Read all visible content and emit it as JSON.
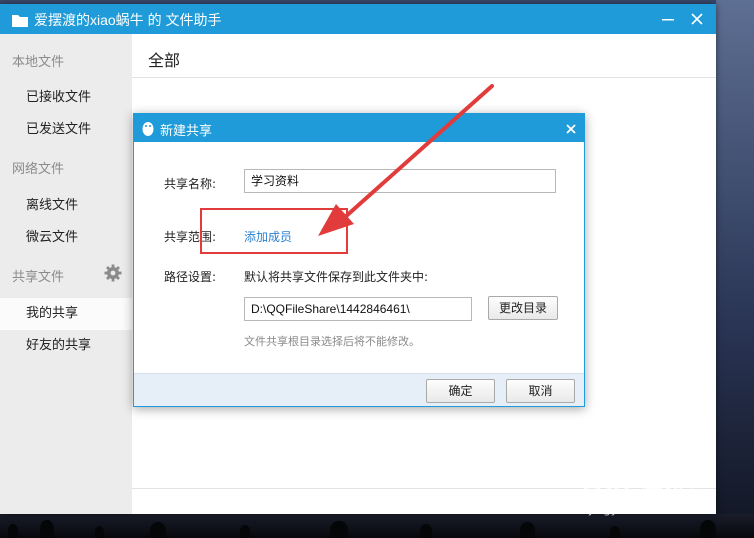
{
  "window": {
    "title": "爱摆渡的xiao蜗牛 的 文件助手"
  },
  "sidebar": {
    "local_category": "本地文件",
    "received": "已接收文件",
    "sent": "已发送文件",
    "network_category": "网络文件",
    "offline": "离线文件",
    "cloud": "微云文件",
    "share_category": "共享文件",
    "my_share": "我的共享",
    "friend_share": "好友的共享",
    "active_item": "我的共享"
  },
  "main": {
    "title": "全部"
  },
  "dialog": {
    "title": "新建共享",
    "name_label": "共享名称:",
    "name_value": "学习资料",
    "scope_label": "共享范围:",
    "add_member": "添加成员",
    "path_label": "路径设置:",
    "path_desc": "默认将共享文件保存到此文件夹中:",
    "path_value": "D:\\QQFileShare\\1442846461\\",
    "change_dir": "更改目录",
    "hint": "文件共享根目录选择后将不能修改。",
    "confirm": "确定",
    "cancel": "取消"
  },
  "annotation": {
    "color": "#e23b3b"
  },
  "watermark": {
    "brand": "Bai 经验",
    "url": "jingyan.baidu.com"
  },
  "colors": {
    "accent": "#1e9bd8",
    "link": "#2b7fd2"
  },
  "icons": [
    "folder-icon",
    "minimize-icon",
    "close-icon",
    "gear-icon",
    "qq-penguin-icon",
    "paw-icon"
  ]
}
